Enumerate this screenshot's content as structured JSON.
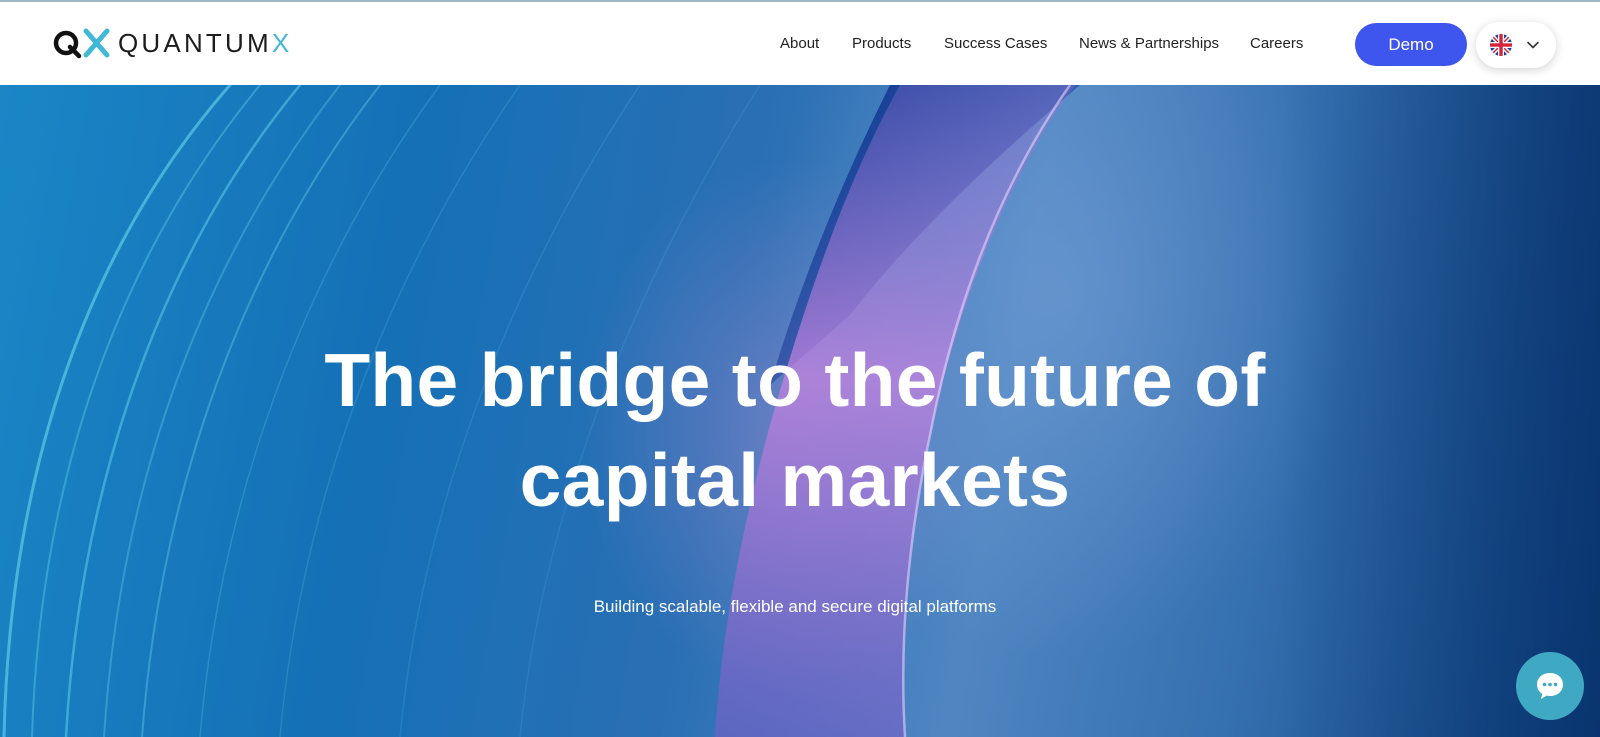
{
  "brand": {
    "wordmark_main": "QUANTUM",
    "wordmark_accent": "X",
    "accent_color": "#41b8d6"
  },
  "nav": {
    "items": [
      {
        "label": "About"
      },
      {
        "label": "Products"
      },
      {
        "label": "Success Cases"
      },
      {
        "label": "News & Partnerships"
      },
      {
        "label": "Careers"
      }
    ]
  },
  "actions": {
    "demo_label": "Demo",
    "demo_color": "#3e55ee",
    "language_flag": "uk-flag-icon",
    "language_chevron": "chevron-down-icon"
  },
  "hero": {
    "headline_line1": "The bridge to the future of",
    "headline_line2": "capital markets",
    "subheadline": "Building scalable, flexible and secure digital platforms"
  },
  "chat": {
    "icon": "chat-bubble-icon",
    "color": "#3fa9c4"
  }
}
